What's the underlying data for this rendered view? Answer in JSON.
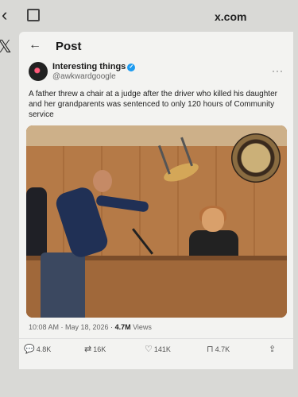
{
  "browser": {
    "url": "x.com"
  },
  "header": {
    "title": "Post"
  },
  "author": {
    "display_name": "Interesting things",
    "handle": "@awkwardgoogle"
  },
  "post": {
    "text": "A father threw a chair at a judge after the driver who killed his daughter and her grandparents was sentenced to only 120 hours of Community service",
    "time": "10:08 AM · May 18, 2026 · ",
    "views_count": "4.7M",
    "views_label": " Views"
  },
  "actions": {
    "replies": "4.8K",
    "reposts": "16K",
    "likes": "141K",
    "bookmarks": "4.7K"
  }
}
